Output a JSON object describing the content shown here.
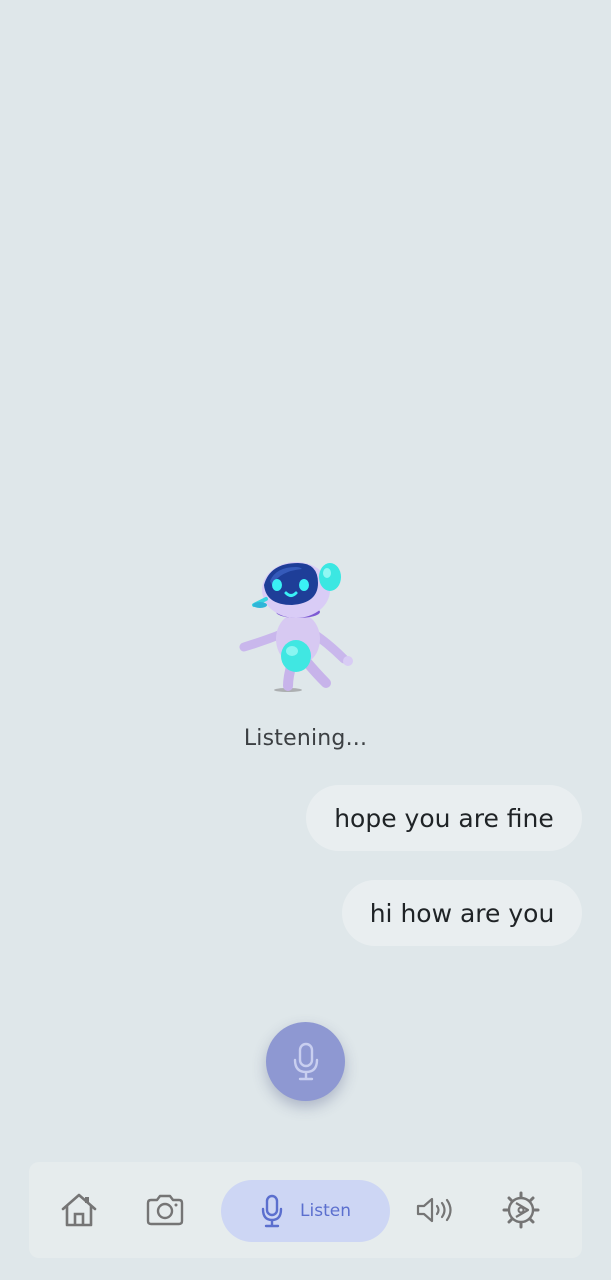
{
  "status_text": "Listening...",
  "messages": [
    {
      "text": "hope you are fine"
    },
    {
      "text": "hi how are you"
    }
  ],
  "nav": {
    "home": {
      "icon": "home-icon"
    },
    "camera": {
      "icon": "camera-icon"
    },
    "listen": {
      "icon": "microphone-icon",
      "label": "Listen"
    },
    "speaker": {
      "icon": "speaker-icon"
    },
    "settings": {
      "icon": "settings-icon"
    }
  },
  "colors": {
    "background": "#dfe7ea",
    "bubble": "#e9eef0",
    "mic_button": "#8e98d2",
    "nav_active_bg": "#cdd6f4",
    "nav_active_text": "#5b6fce",
    "icon_gray": "#757575"
  }
}
